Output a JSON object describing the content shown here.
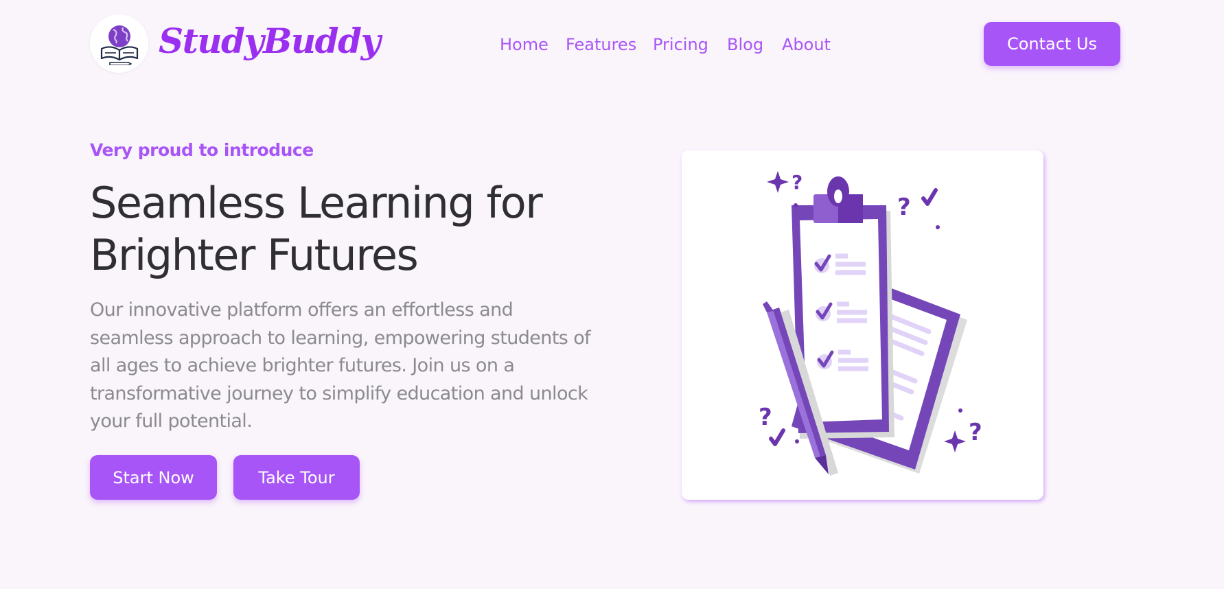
{
  "brand": {
    "name": "StudyBuddy",
    "logo_icon": "globe-book-icon"
  },
  "nav": {
    "items": [
      {
        "label": "Home"
      },
      {
        "label": "Features"
      },
      {
        "label": "Pricing"
      },
      {
        "label": "Blog"
      },
      {
        "label": "About"
      }
    ],
    "contact_label": "Contact Us"
  },
  "hero": {
    "eyebrow": "Very proud to introduce",
    "title": "Seamless Learning for Brighter Futures",
    "description": "Our innovative platform offers an effortless and seamless approach to learning, empowering students of all ages to achieve brighter futures. Join us on a transformative journey to simplify education and unlock your full potential.",
    "start_label": "Start Now",
    "tour_label": "Take Tour",
    "illustration_icon": "clipboard-checklist-illustration"
  },
  "colors": {
    "accent": "#a855f7",
    "brand_text": "#9a2ff0",
    "nav_text": "#a855f7",
    "title_text": "#2f2f33",
    "body_text": "#8a8a8f",
    "background": "#faf4fb",
    "illustration_purple": "#6f3fb0"
  }
}
